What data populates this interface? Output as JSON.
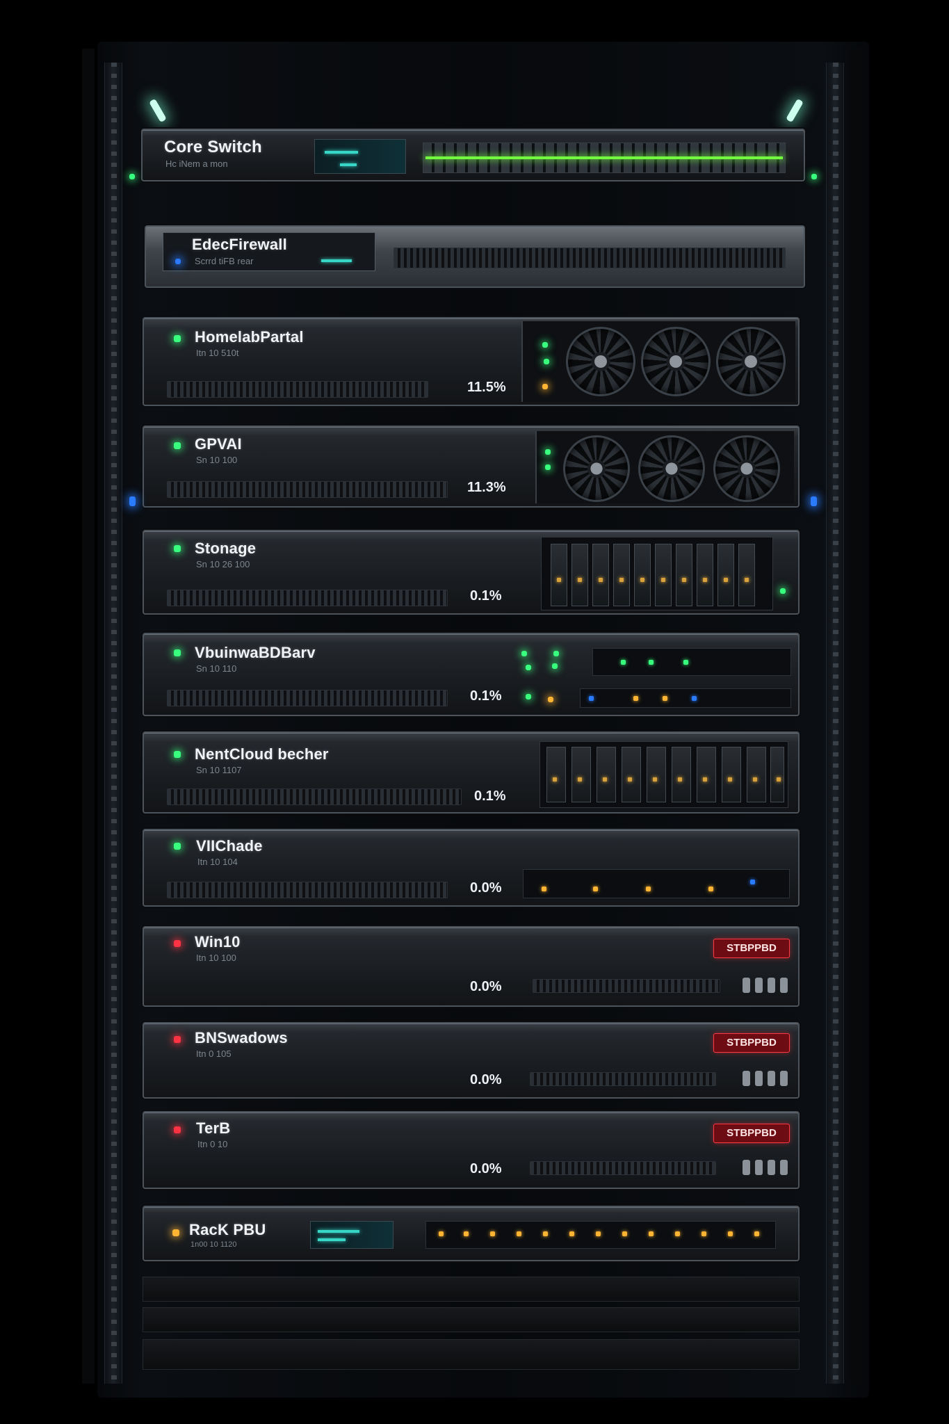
{
  "rack": {
    "devices": [
      {
        "id": "core-switch",
        "name": "Core Switch",
        "sub": "Hc iNem a mon"
      },
      {
        "id": "edge-firewall",
        "name": "EdecFirewall",
        "sub": "Scrrd tiFB rear"
      },
      {
        "id": "homelab-portal",
        "name": "HomelabPartal",
        "sub": "Itn 10 510t",
        "usage": "11.5%",
        "status": "running"
      },
      {
        "id": "gpvai",
        "name": "GPVAI",
        "sub": "Sn 10 100",
        "usage": "11.3%",
        "status": "running"
      },
      {
        "id": "storage",
        "name": "Stonage",
        "sub": "Sn 10 26 100",
        "usage": "0.1%",
        "status": "running"
      },
      {
        "id": "vbuinwa",
        "name": "VbuinwaBDBarv",
        "sub": "Sn 10 110",
        "usage": "0.1%",
        "status": "running"
      },
      {
        "id": "nentcloud",
        "name": "NentCloud becher",
        "sub": "Sn 10 1107",
        "usage": "0.1%",
        "status": "running"
      },
      {
        "id": "vilchade",
        "name": "VIIChade",
        "sub": "Itn 10 104",
        "usage": "0.0%",
        "status": "running"
      },
      {
        "id": "win10",
        "name": "Win10",
        "sub": "Itn 10 100",
        "usage": "0.0%",
        "status": "stopped",
        "badge": "STBPPBD"
      },
      {
        "id": "bnswindows",
        "name": "BNSwadows",
        "sub": "Itn 0 105",
        "usage": "0.0%",
        "status": "stopped",
        "badge": "STBPPBD"
      },
      {
        "id": "terb",
        "name": "TerB",
        "sub": "Itn 0 10",
        "usage": "0.0%",
        "status": "stopped",
        "badge": "STBPPBD"
      },
      {
        "id": "rack-pdu",
        "name": "RacK PBU",
        "sub": "1n00 10 1120"
      }
    ]
  },
  "colors": {
    "running": "#39ff7e",
    "stopped": "#ff3344",
    "power": "#ffb533",
    "badge": "#6d0c12"
  }
}
